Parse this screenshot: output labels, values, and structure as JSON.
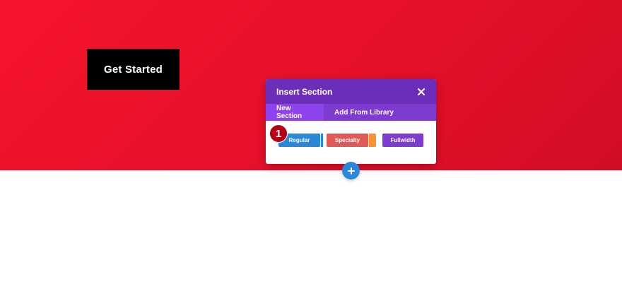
{
  "hero": {
    "button_label": "Get Started",
    "background_color": "#e8102a"
  },
  "modal": {
    "title": "Insert Section",
    "close_icon": "close-icon",
    "tabs": [
      {
        "label": "New Section",
        "active": true
      },
      {
        "label": "Add From Library",
        "active": false
      }
    ],
    "layout_buttons": [
      {
        "label": "Regular",
        "color": "#2b87da"
      },
      {
        "label": "Specialty",
        "color": "#e05b58"
      },
      {
        "label": "Fullwidth",
        "color": "#7e3bd0"
      }
    ],
    "header_color": "#6c2eb9",
    "tabs_color": "#7d3bcf"
  },
  "annotation": {
    "step_number": "1"
  },
  "add_button": {
    "icon": "plus-icon",
    "color": "#2b87da"
  }
}
